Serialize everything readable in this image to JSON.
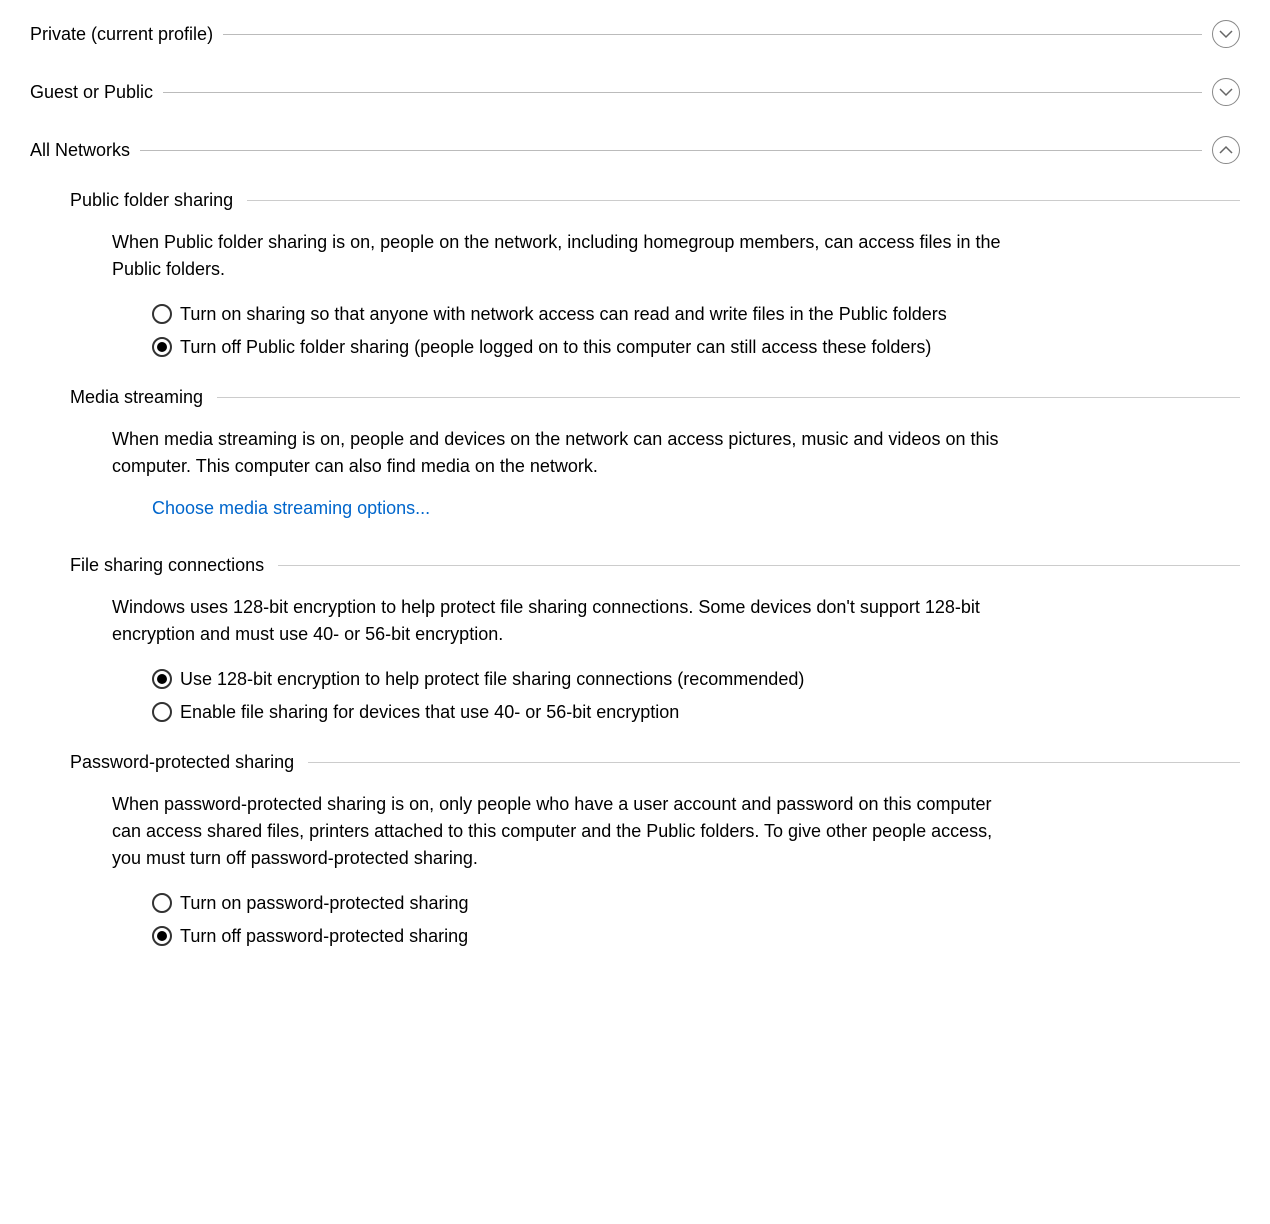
{
  "profiles": {
    "private": {
      "label": "Private (current profile)",
      "expanded": false
    },
    "guest": {
      "label": "Guest or Public",
      "expanded": false
    },
    "all": {
      "label": "All Networks",
      "expanded": true
    }
  },
  "publicFolderSharing": {
    "title": "Public folder sharing",
    "description": "When Public folder sharing is on, people on the network, including homegroup members, can access files in the Public folders.",
    "options": {
      "on": {
        "label": "Turn on sharing so that anyone with network access can read and write files in the Public folders",
        "checked": false
      },
      "off": {
        "label": "Turn off Public folder sharing (people logged on to this computer can still access these folders)",
        "checked": true
      }
    }
  },
  "mediaStreaming": {
    "title": "Media streaming",
    "description": "When media streaming is on, people and devices on the network can access pictures, music and videos on this computer. This computer can also find media on the network.",
    "link": "Choose media streaming options..."
  },
  "fileSharingConnections": {
    "title": "File sharing connections",
    "description": "Windows uses 128-bit encryption to help protect file sharing connections. Some devices don't support 128-bit encryption and must use 40- or 56-bit encryption.",
    "options": {
      "e128": {
        "label": "Use 128-bit encryption to help protect file sharing connections (recommended)",
        "checked": true
      },
      "e40": {
        "label": "Enable file sharing for devices that use 40- or 56-bit encryption",
        "checked": false
      }
    }
  },
  "passwordProtectedSharing": {
    "title": "Password-protected sharing",
    "description": "When password-protected sharing is on, only people who have a user account and password on this computer can access shared files, printers attached to this computer and the Public folders. To give other people access, you must turn off password-protected sharing.",
    "options": {
      "on": {
        "label": "Turn on password-protected sharing",
        "checked": false
      },
      "off": {
        "label": "Turn off password-protected sharing",
        "checked": true
      }
    }
  }
}
